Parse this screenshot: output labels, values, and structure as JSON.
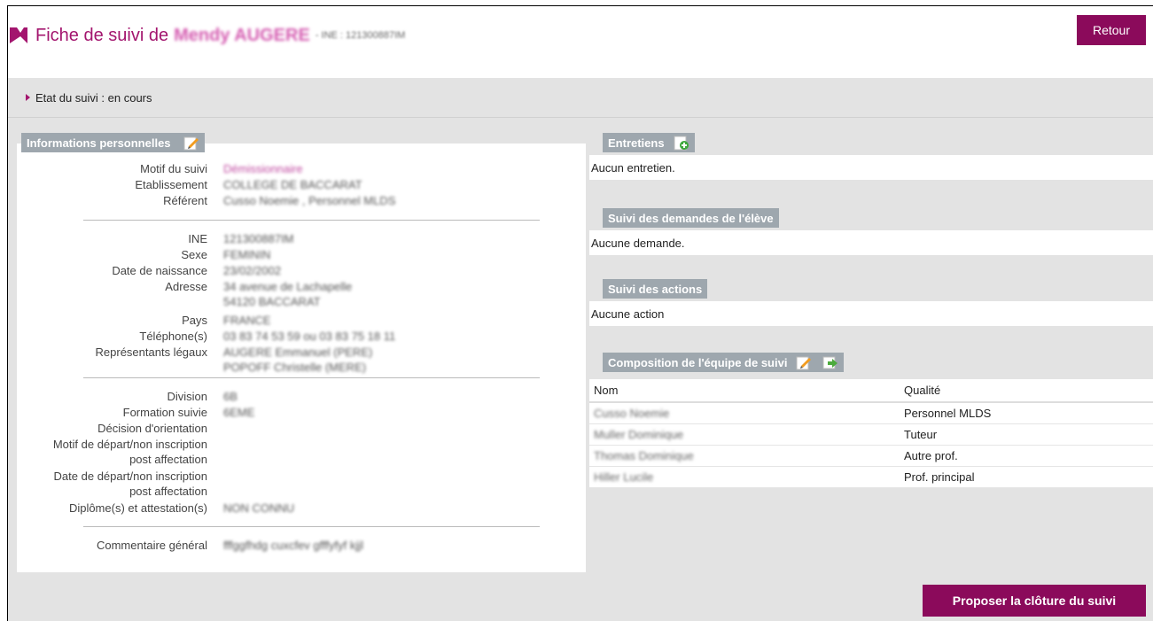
{
  "header": {
    "title_prefix": "Fiche de suivi de",
    "student_name": "Mendy AUGERE",
    "ine_inline": "- INE : 121300887IM",
    "back_label": "Retour"
  },
  "state": {
    "label": "Etat du suivi : en cours"
  },
  "personal": {
    "section_title": "Informations personnelles",
    "motif_label": "Motif du suivi",
    "motif_value": "Démissionnaire",
    "etab_label": "Etablissement",
    "etab_value": "COLLEGE DE BACCARAT",
    "ref_label": "Référent",
    "ref_value": "Cusso Noemie , Personnel MLDS",
    "ine_label": "INE",
    "ine_value": "121300887IM",
    "sexe_label": "Sexe",
    "sexe_value": "FEMININ",
    "dob_label": "Date de naissance",
    "dob_value": "23/02/2002",
    "addr_label": "Adresse",
    "addr_line1": "34 avenue de Lachapelle",
    "addr_line2": "54120 BACCARAT",
    "pays_label": "Pays",
    "pays_value": "FRANCE",
    "tel_label": "Téléphone(s)",
    "tel_value": "03 83 74 53 59 ou 03 83 75 18 11",
    "rep_label": "Représentants légaux",
    "rep_line1": "AUGERE Emmanuel (PERE)",
    "rep_line2": "POPOFF Christelle (MERE)",
    "div_label": "Division",
    "div_value": "6B",
    "form_label": "Formation suivie",
    "form_value": "6EME",
    "dec_label": "Décision d'orientation",
    "motif_dep_label1": "Motif de départ/non inscription",
    "motif_dep_label2": "post affectation",
    "date_dep_label1": "Date de départ/non inscription",
    "date_dep_label2": "post affectation",
    "dipl_label": "Diplôme(s) et attestation(s)",
    "dipl_value": "NON CONNU",
    "comm_label": "Commentaire général",
    "comm_value": "fffggfhdg cuxcfev gfffyfyf kjjl"
  },
  "entretiens": {
    "title": "Entretiens",
    "empty": "Aucun entretien."
  },
  "demandes": {
    "title": "Suivi des demandes de l'élève",
    "empty": "Aucune demande."
  },
  "actions": {
    "title": "Suivi des actions",
    "empty": "Aucune action"
  },
  "team": {
    "title": "Composition de l'équipe de suivi",
    "col_nom": "Nom",
    "col_qualite": "Qualité",
    "rows": [
      {
        "nom": "Cusso Noemie",
        "qualite": "Personnel MLDS"
      },
      {
        "nom": "Muller Dominique",
        "qualite": "Tuteur"
      },
      {
        "nom": "Thomas Dominique",
        "qualite": "Autre prof."
      },
      {
        "nom": "Hiller Lucile",
        "qualite": "Prof. principal"
      }
    ]
  },
  "footer": {
    "close_label": "Proposer la clôture du suivi"
  }
}
